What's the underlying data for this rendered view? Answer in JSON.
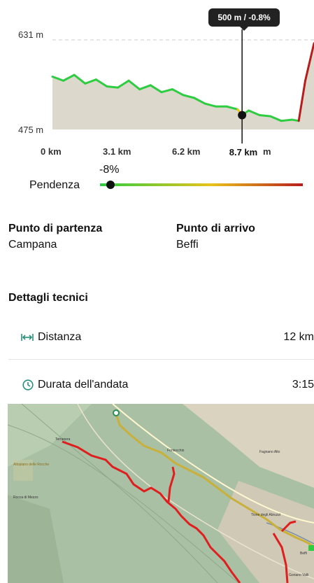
{
  "elevation_chart": {
    "y_max_label": "631 m",
    "y_min_label": "475 m",
    "x_ticks": [
      "0 km",
      "3.1 km",
      "6.2 km",
      "m"
    ],
    "cursor_x_label": "8.7 km",
    "tooltip": "500 m / -0.8%"
  },
  "slope": {
    "label": "Pendenza",
    "value": "-8%"
  },
  "start": {
    "label": "Punto di partenza",
    "value": "Campana"
  },
  "end": {
    "label": "Punto di arrivo",
    "value": "Beffi"
  },
  "technical": {
    "title": "Dettagli tecnici",
    "distance_label": "Distanza",
    "distance_value": "12 km",
    "duration_label": "Durata dell'andata",
    "duration_value": "3:15"
  },
  "map": {
    "labels": [
      "Terranera",
      "Rocca di Mezzo",
      "Altopiano delle Rocche",
      "Fontecchio",
      "Fagnano Alto",
      "Tione degli Abruzzi",
      "Goriano Valli",
      "Beffi"
    ]
  },
  "colors": {
    "slope_low": "#2ecc40",
    "slope_mid": "#e8c31a",
    "slope_high": "#b81c1c",
    "route_red": "#e01e1e",
    "route_gold": "#c9b03a"
  },
  "chart_data": {
    "type": "area",
    "title": "",
    "xlabel": "",
    "ylabel": "",
    "x_unit": "km",
    "y_unit": "m",
    "xlim": [
      0,
      12
    ],
    "ylim": [
      475,
      631
    ],
    "x": [
      0,
      0.5,
      1,
      1.5,
      2,
      2.5,
      3,
      3.5,
      4,
      4.5,
      5,
      5.5,
      6,
      6.5,
      7,
      7.5,
      8,
      8.5,
      8.7,
      9,
      9.5,
      10,
      10.5,
      11,
      11.3,
      11.6,
      12
    ],
    "y": [
      567,
      560,
      570,
      555,
      562,
      550,
      548,
      560,
      545,
      552,
      540,
      545,
      535,
      530,
      520,
      515,
      515,
      510,
      500,
      508,
      500,
      498,
      490,
      492,
      490,
      560,
      625
    ],
    "cursor": {
      "x": 8.7,
      "y": 500
    }
  }
}
